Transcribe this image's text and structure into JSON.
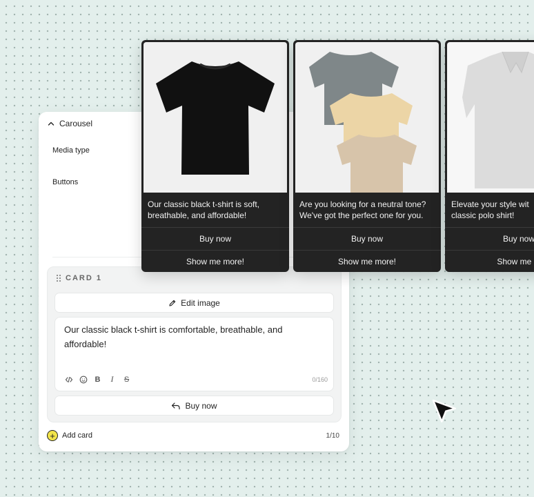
{
  "panel": {
    "section_title": "Carousel",
    "media_type_label": "Media type",
    "buttons_label": "Buttons",
    "card_title": "CARD 1",
    "edit_image_label": "Edit image",
    "message_text": "Our classic black t-shirt is comfortable, breathable, and affordable!",
    "char_counter": "0/160",
    "reply_button_label": "Buy now",
    "add_card_label": "Add card",
    "card_count": "1/10"
  },
  "toolbar_icons": [
    "code-icon",
    "emoji-icon",
    "bold-icon",
    "italic-icon",
    "strikethrough-icon"
  ],
  "preview_cards": [
    {
      "description_line1": "Our classic black t-shirt is soft,",
      "description_line2": "breathable, and affordable!",
      "button1": "Buy now",
      "button2": "Show me more!",
      "image": "black-tshirt"
    },
    {
      "description_line1": "Are you looking for a neutral tone?",
      "description_line2": "We've got the perfect one for you.",
      "button1": "Buy now",
      "button2": "Show me more!",
      "image": "neutral-tshirts-stack"
    },
    {
      "description_line1": "Elevate your style wit",
      "description_line2": "classic polo shirt!",
      "button1": "Buy now",
      "button2": "Show me m",
      "image": "white-polo"
    }
  ],
  "colors": {
    "background": "#e3efec",
    "card_dark": "#232323",
    "accent_yellow": "#f2e44a"
  }
}
